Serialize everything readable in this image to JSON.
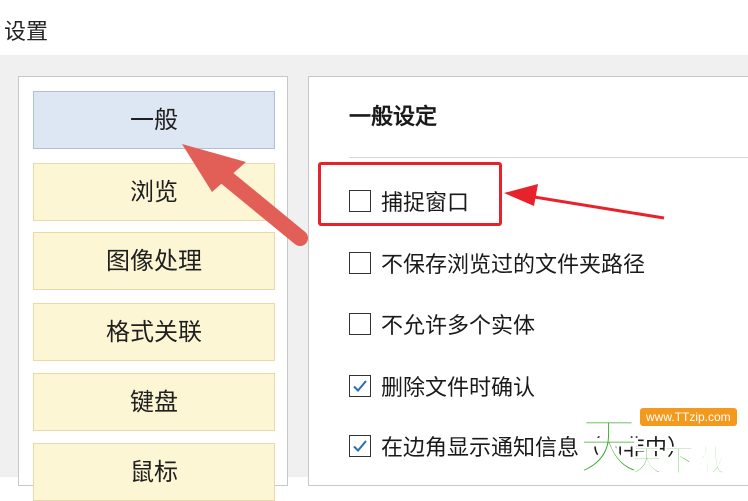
{
  "window": {
    "title": "设置"
  },
  "sidebar": {
    "items": [
      {
        "label": "一般",
        "selected": true
      },
      {
        "label": "浏览",
        "selected": false
      },
      {
        "label": "图像处理",
        "selected": false
      },
      {
        "label": "格式关联",
        "selected": false
      },
      {
        "label": "键盘",
        "selected": false
      },
      {
        "label": "鼠标",
        "selected": false
      }
    ]
  },
  "main": {
    "section_title": "一般设定",
    "options": [
      {
        "label": "捕捉窗口",
        "checked": false
      },
      {
        "label": "不保存浏览过的文件夹路径",
        "checked": false
      },
      {
        "label": "不允许多个实体",
        "checked": false
      },
      {
        "label": "删除文件时确认",
        "checked": true
      },
      {
        "label": "在边角显示通知信息（向非中）",
        "checked": true
      }
    ]
  },
  "watermark": {
    "big": "天",
    "url": "www.TTzip.com",
    "small": "天下载"
  },
  "colors": {
    "selected_bg": "#dde6f3",
    "item_bg": "#fdf6d5",
    "annotation_red": "#e8222a",
    "check_blue": "#2a6db5",
    "watermark_green": "#38a62c",
    "watermark_orange": "#f39a1e"
  }
}
